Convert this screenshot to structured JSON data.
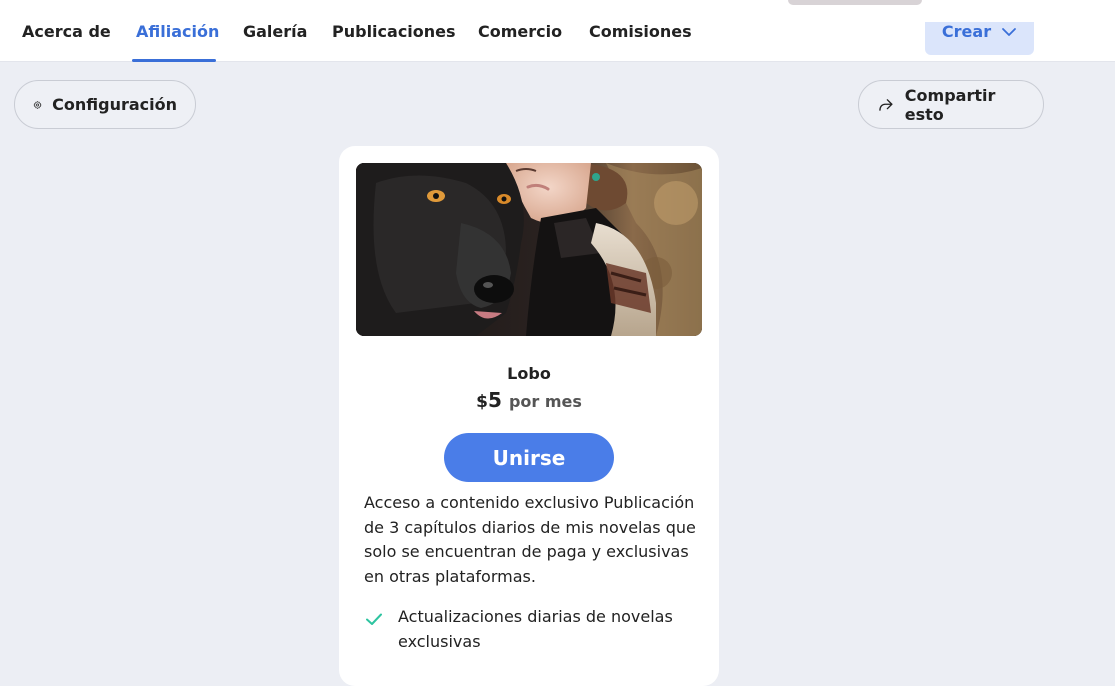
{
  "nav": {
    "tabs": [
      {
        "label": "Acerca de",
        "active": false
      },
      {
        "label": "Afiliación",
        "active": true
      },
      {
        "label": "Galería",
        "active": false
      },
      {
        "label": "Publicaciones",
        "active": false
      },
      {
        "label": "Comercio",
        "active": false
      },
      {
        "label": "Comisiones",
        "active": false
      }
    ],
    "create_label": "Crear",
    "create_icon": "chevron-down-icon"
  },
  "actions": {
    "settings_label": "Configuración",
    "settings_icon": "gear-icon",
    "share_label": "Compartir esto",
    "share_icon": "share-arrow-icon"
  },
  "tier": {
    "name": "Lobo",
    "currency": "$",
    "amount": "5",
    "period": "por mes",
    "join_label": "Unirse",
    "description": "Acceso a contenido exclusivo Publicación de 3 capítulos diarios de mis novelas que solo se encuentran de paga y exclusivas en otras plataformas.",
    "benefits": [
      {
        "text": "Actualizaciones diarias de novelas exclusivas",
        "icon": "check-icon"
      }
    ]
  },
  "colors": {
    "accent": "#3a6fd8",
    "join_button": "#4a7de8",
    "check": "#2ec4a0",
    "page_background": "#eceef4"
  }
}
